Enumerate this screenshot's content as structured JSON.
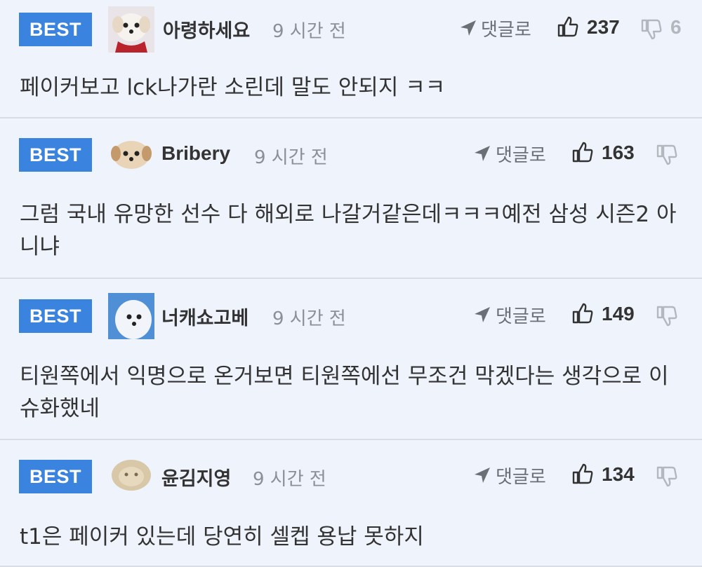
{
  "comments": [
    {
      "badge": "BEST",
      "avatar": "white-dog-red-scarf",
      "username": "아령하세요",
      "time": "9 시간 전",
      "reply_label": "댓글로",
      "likes": "237",
      "dislikes": "6",
      "text": "페이커보고 lck나가란 소린데 말도 안되지 ㅋㅋ"
    },
    {
      "badge": "BEST",
      "avatar": "puppy-face",
      "username": "Bribery",
      "time": "9 시간 전",
      "reply_label": "댓글로",
      "likes": "163",
      "dislikes": "",
      "text": "그럼 국내 유망한 선수 다 해외로 나갈거같은데ㅋㅋㅋ예전 삼성 시즌2 아니냐"
    },
    {
      "badge": "BEST",
      "avatar": "white-fluffy-dog",
      "username": "너캐쇼고베",
      "time": "9 시간 전",
      "reply_label": "댓글로",
      "likes": "149",
      "dislikes": "",
      "text": "티원쪽에서 익명으로 온거보면 티원쪽에선 무조건 막겠다는 생각으로 이슈화했네"
    },
    {
      "badge": "BEST",
      "avatar": "beige-dog-blur",
      "username": "윤김지영",
      "time": "9 시간 전",
      "reply_label": "댓글로",
      "likes": "134",
      "dislikes": "",
      "text": "t1은 페이커 있는데 당연히 셀켑 용납 못하지"
    }
  ],
  "colors": {
    "background": "#eef3fc",
    "badge": "#3a84df",
    "divider": "#d9dee6",
    "time": "#8a8f98",
    "dislike": "#b3b7be"
  },
  "icons": {
    "reply": "reply-arrow-icon",
    "like": "thumbs-up-icon",
    "dislike": "thumbs-down-icon"
  }
}
